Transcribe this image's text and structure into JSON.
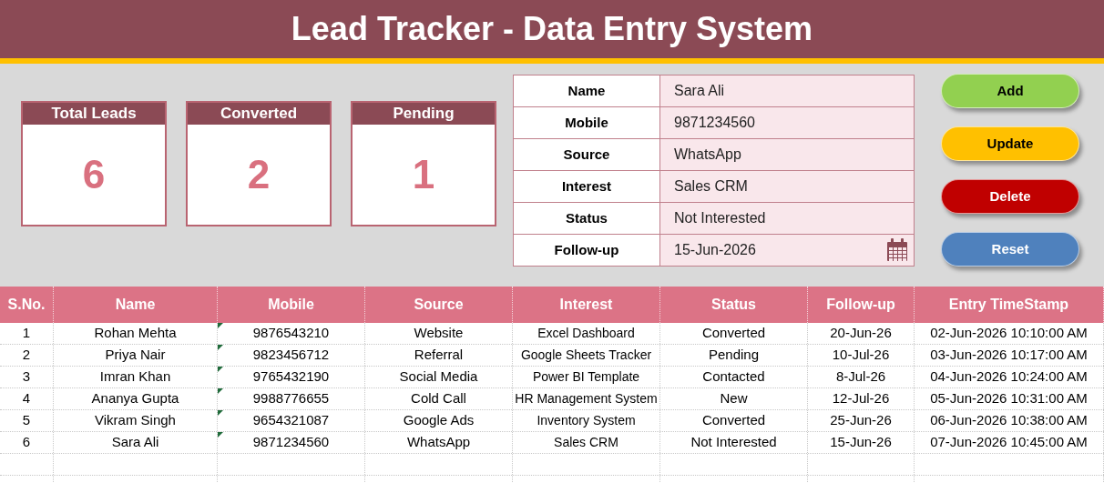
{
  "title": "Lead Tracker - Data Entry System",
  "cards": [
    {
      "label": "Total Leads",
      "value": "6"
    },
    {
      "label": "Converted",
      "value": "2"
    },
    {
      "label": "Pending",
      "value": "1"
    }
  ],
  "form": [
    {
      "label": "Name",
      "value": "Sara Ali",
      "kind": "text"
    },
    {
      "label": "Mobile",
      "value": "9871234560",
      "kind": "text"
    },
    {
      "label": "Source",
      "value": "WhatsApp",
      "kind": "text"
    },
    {
      "label": "Interest",
      "value": "Sales CRM",
      "kind": "text"
    },
    {
      "label": "Status",
      "value": "Not Interested",
      "kind": "text"
    },
    {
      "label": "Follow-up",
      "value": "15-Jun-2026",
      "kind": "date"
    }
  ],
  "buttons": [
    {
      "label": "Add",
      "color": "#92d050"
    },
    {
      "label": "Update",
      "color": "#ffc000"
    },
    {
      "label": "Delete",
      "color": "#c00000"
    },
    {
      "label": "Reset",
      "color": "#4f81bd"
    }
  ],
  "table": {
    "columns": [
      "S.No.",
      "Name",
      "Mobile",
      "Source",
      "Interest",
      "Status",
      "Follow-up",
      "Entry TimeStamp"
    ],
    "rows": [
      {
        "cells": [
          "1",
          "Rohan Mehta",
          "9876543210",
          "Website",
          "Excel Dashboard",
          "Converted",
          "20-Jun-26",
          "02-Jun-2026 10:10:00 AM"
        ],
        "mobile_flagged": true
      },
      {
        "cells": [
          "2",
          "Priya Nair",
          "9823456712",
          "Referral",
          "Google Sheets Tracker",
          "Pending",
          "10-Jul-26",
          "03-Jun-2026 10:17:00 AM"
        ],
        "mobile_flagged": true
      },
      {
        "cells": [
          "3",
          "Imran Khan",
          "9765432190",
          "Social Media",
          "Power BI Template",
          "Contacted",
          "8-Jul-26",
          "04-Jun-2026 10:24:00 AM"
        ],
        "mobile_flagged": true
      },
      {
        "cells": [
          "4",
          "Ananya Gupta",
          "9988776655",
          "Cold Call",
          "HR Management System",
          "New",
          "12-Jul-26",
          "05-Jun-2026 10:31:00 AM"
        ],
        "mobile_flagged": true
      },
      {
        "cells": [
          "5",
          "Vikram Singh",
          "9654321087",
          "Google Ads",
          "Inventory System",
          "Converted",
          "25-Jun-26",
          "06-Jun-2026 10:38:00 AM"
        ],
        "mobile_flagged": true
      },
      {
        "cells": [
          "6",
          "Sara Ali",
          "9871234560",
          "WhatsApp",
          "Sales CRM",
          "Not Interested",
          "15-Jun-26",
          "07-Jun-2026 10:45:00 AM"
        ],
        "mobile_flagged": true
      }
    ]
  }
}
